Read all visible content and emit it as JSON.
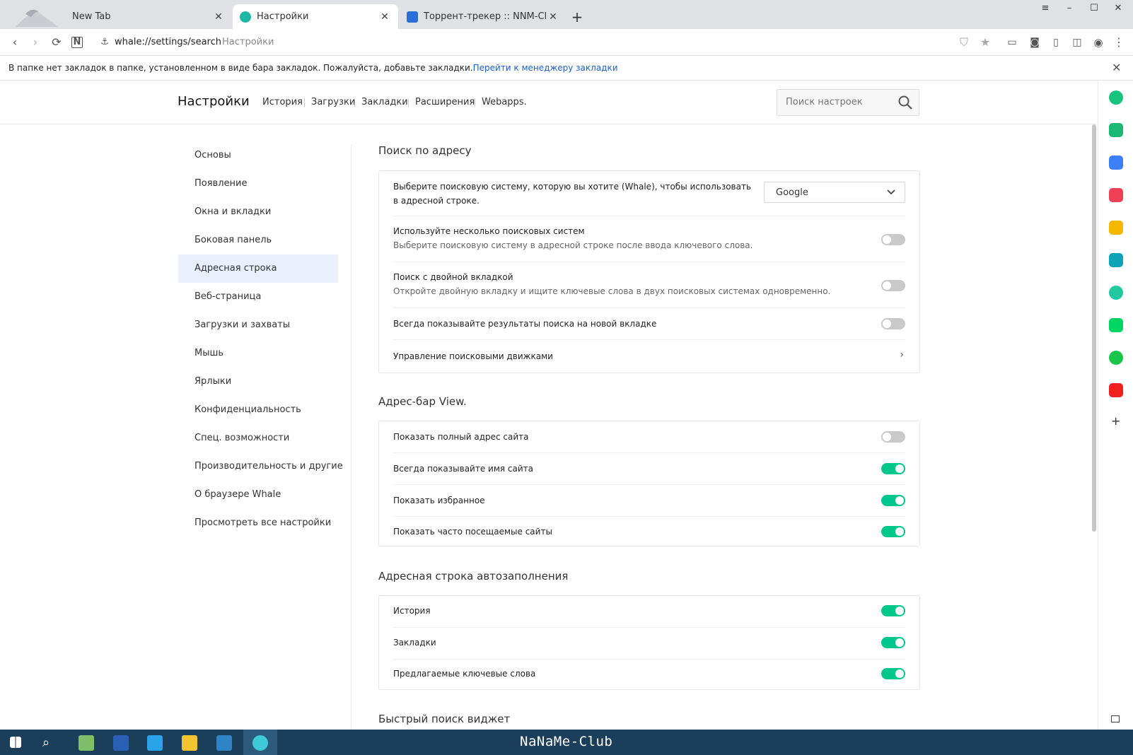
{
  "tabs": [
    {
      "title": "New Tab",
      "close": "✕"
    },
    {
      "title": "Настройки",
      "close": "✕"
    },
    {
      "title": "Торрент-трекер :: NNM-Club",
      "close": "✕"
    }
  ],
  "new_tab": "+",
  "window_controls": {
    "minimize": "–",
    "maximize": "☐",
    "close": "✕",
    "menu": "≡"
  },
  "address_bar": {
    "url": "whale://settings/search",
    "page_title": "Настройки"
  },
  "bookmark_bar": {
    "message": "В папке нет закладок в папке, установленном в виде бара закладок. Пожалуйста, добавьте закладки.",
    "link": "Перейти к менеджеру закладки",
    "close": "✕"
  },
  "header": {
    "title": "Настройки",
    "nav": [
      "История",
      "Загрузки",
      "Закладки",
      "Расширения",
      "Webapps."
    ],
    "search_placeholder": "Поиск настроек"
  },
  "sidebar_nav": [
    "Основы",
    "Появление",
    "Окна и вкладки",
    "Боковая панель",
    "Адресная строка",
    "Веб-страница",
    "Загрузки и захваты",
    "Мышь",
    "Ярлыки",
    "Конфиденциальность",
    "Спец. возможности",
    "Производительность и другие",
    "О браузере Whale",
    "Просмотреть все настройки"
  ],
  "sidebar_active": "Адресная строка",
  "sections": {
    "search": {
      "title": "Поиск по адресу",
      "engine_label": "Выберите поисковую систему, которую вы хотите (Whale), чтобы использовать в адресной строке.",
      "engine_value": "Google",
      "multi_label": "Используйте несколько поисковых систем",
      "multi_sub": "Выберите поисковую систему в адресной строке после ввода ключевого слова.",
      "multi_on": false,
      "dual_label": "Поиск с двойной вкладкой",
      "dual_sub": "Откройте двойную вкладку и ищите ключевые слова в двух поисковых системах одновременно.",
      "dual_on": false,
      "newtab_label": "Всегда показывайте результаты поиска на новой вкладке",
      "newtab_on": false,
      "manage_label": "Управление поисковыми движками"
    },
    "view": {
      "title": "Адрес-бар View.",
      "items": [
        {
          "label": "Показать полный адрес сайта",
          "on": false
        },
        {
          "label": "Всегда показывайте имя сайта",
          "on": true
        },
        {
          "label": "Показать избранное",
          "on": true
        },
        {
          "label": "Показать часто посещаемые сайты",
          "on": true
        }
      ]
    },
    "autocomplete": {
      "title": "Адресная строка автозаполнения",
      "items": [
        {
          "label": "История",
          "on": true
        },
        {
          "label": "Закладки",
          "on": true
        },
        {
          "label": "Предлагаемые ключевые слова",
          "on": true
        }
      ]
    },
    "widget": {
      "title": "Быстрый поиск виджет"
    }
  },
  "taskbar": {
    "brand": "NaNaMe-Club"
  },
  "colors": {
    "accent_green": "#00c88c",
    "active_nav_bg": "#e7f0fb",
    "link_blue": "#1a5fc9",
    "taskbar_bg": "#1b3f5a"
  }
}
